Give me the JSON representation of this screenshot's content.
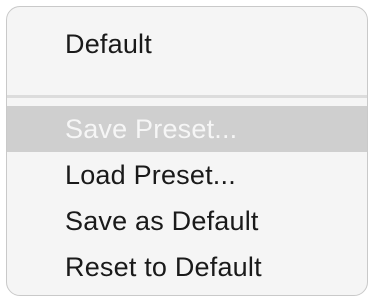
{
  "menu": {
    "items": [
      {
        "label": "Default",
        "state": "normal"
      },
      {
        "label": "Save Preset...",
        "state": "highlighted"
      },
      {
        "label": "Load Preset...",
        "state": "normal"
      },
      {
        "label": "Save as Default",
        "state": "normal"
      },
      {
        "label": "Reset to Default",
        "state": "normal"
      }
    ]
  },
  "colors": {
    "menu_background": "#f5f5f5",
    "highlight_background": "#cfcfcf",
    "highlight_text": "#f6f6f6",
    "text": "#1a1a1a",
    "separator": "#dcdcdc"
  }
}
